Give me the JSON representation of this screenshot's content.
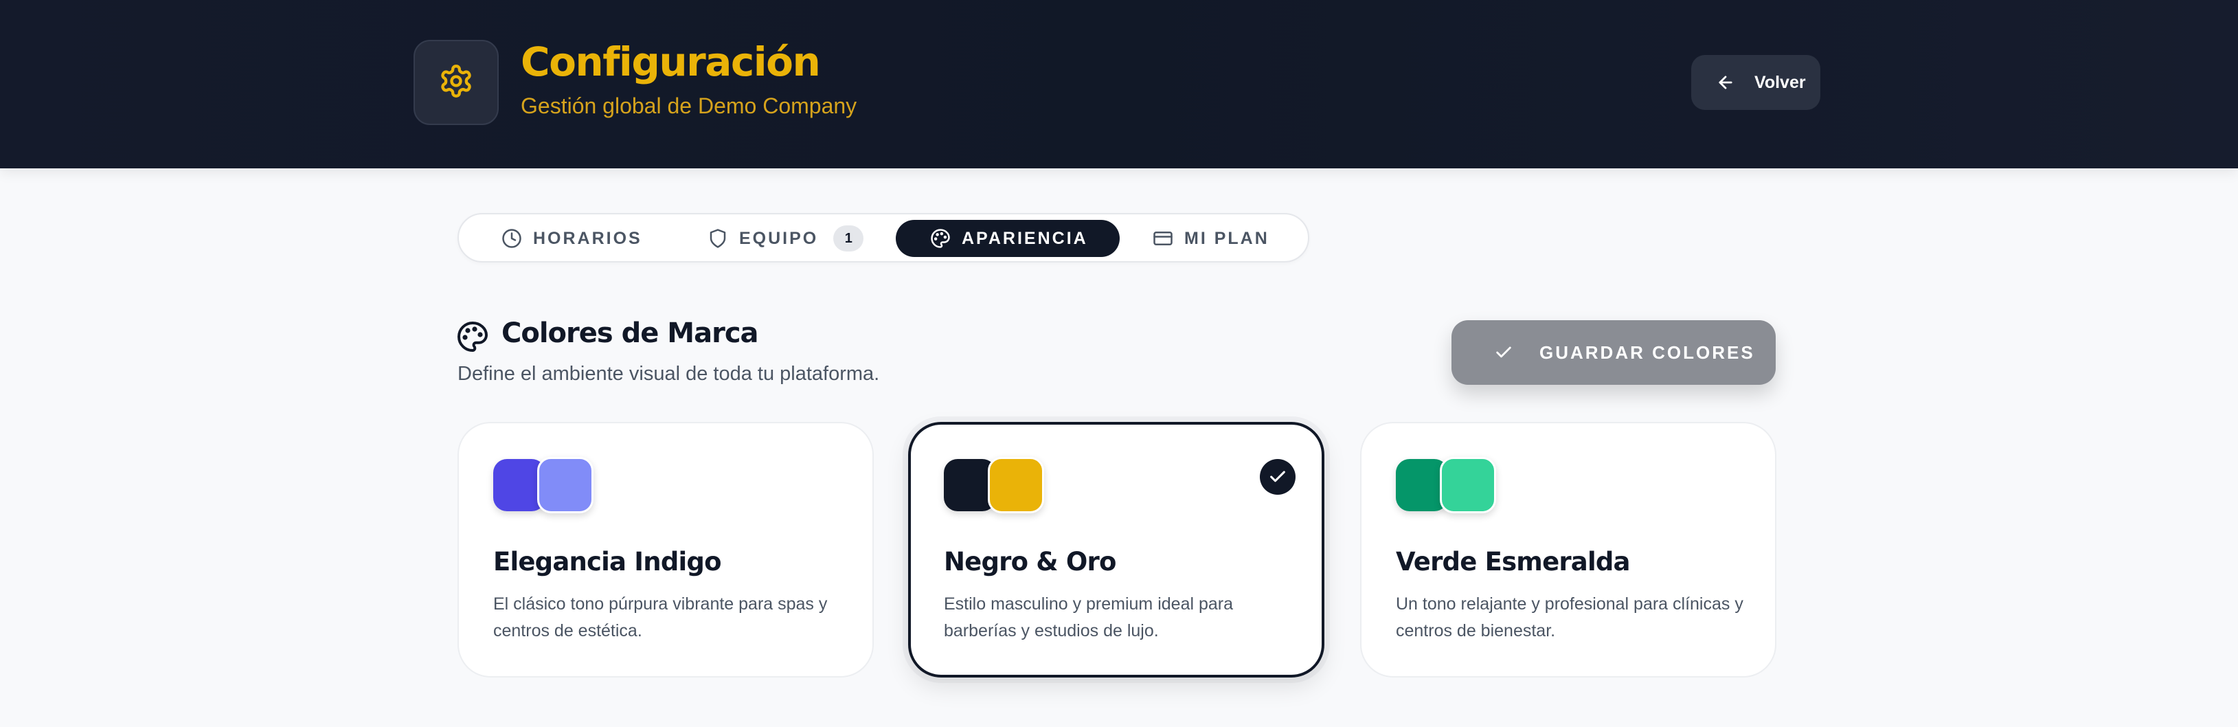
{
  "header": {
    "title": "Configuración",
    "subtitle": "Gestión global de Demo Company",
    "icon": "gear-icon",
    "back_label": "Volver"
  },
  "tabs": [
    {
      "label": "HORARIOS",
      "icon": "clock-icon",
      "active": false
    },
    {
      "label": "EQUIPO",
      "icon": "shield-icon",
      "badge": "1",
      "active": false
    },
    {
      "label": "APARIENCIA",
      "icon": "palette-icon",
      "active": true
    },
    {
      "label": "MI PLAN",
      "icon": "credit-card-icon",
      "active": false
    }
  ],
  "section": {
    "title": "Colores de Marca",
    "subtitle": "Define el ambiente visual de toda tu plataforma.",
    "save_label": "GUARDAR COLORES"
  },
  "themes": [
    {
      "name": "Elegancia Indigo",
      "description": "El clásico tono púrpura vibrante para spas y centros de estética.",
      "primary_color": "#4f46e5",
      "secondary_color": "#818cf8",
      "selected": false
    },
    {
      "name": "Negro & Oro",
      "description": "Estilo masculino y premium ideal para barberías y estudios de lujo.",
      "primary_color": "#111827",
      "secondary_color": "#eab308",
      "selected": true
    },
    {
      "name": "Verde Esmeralda",
      "description": "Un tono relajante y profesional para clínicas y centros de bienestar.",
      "primary_color": "#059669",
      "secondary_color": "#34d399",
      "selected": false
    }
  ],
  "colors": {
    "header_bg": "#111827",
    "accent": "#eab308",
    "save_button_bg": "#8a8d94"
  }
}
